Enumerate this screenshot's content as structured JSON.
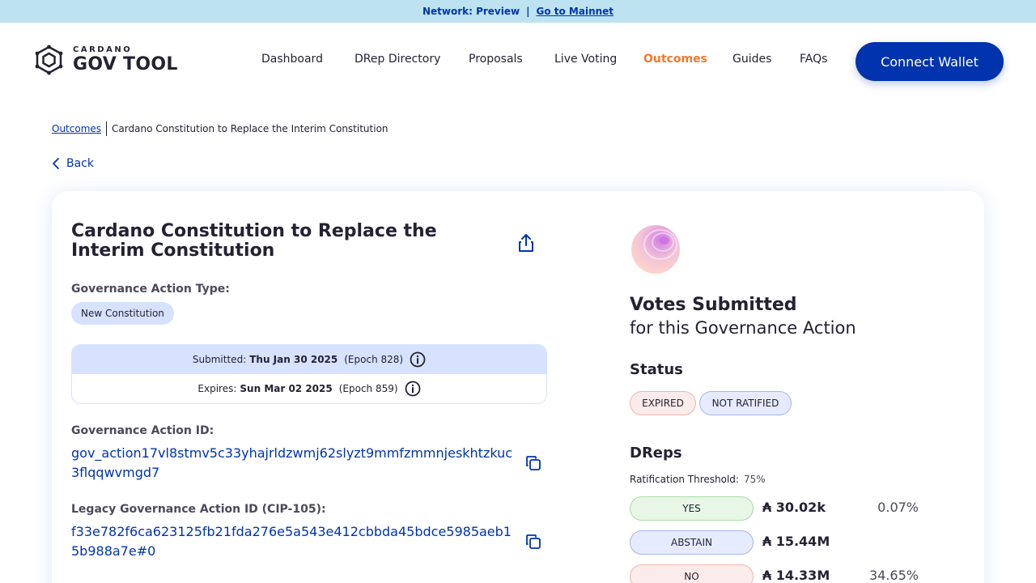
{
  "banner": {
    "network_text": "Network: Preview",
    "separator": "|",
    "mainnet_link": "Go to Mainnet"
  },
  "header": {
    "logo_small": "CARDANO",
    "logo_big": "GOV TOOL",
    "nav": [
      "Dashboard",
      "DRep Directory",
      "Proposals",
      "Live Voting",
      "Outcomes",
      "Guides",
      "FAQs"
    ],
    "active_nav": "Outcomes",
    "connect_label": "Connect Wallet"
  },
  "breadcrumb": {
    "link": "Outcomes",
    "current": "Cardano Constitution to Replace the Interim Constitution"
  },
  "back_label": "Back",
  "action": {
    "title": "Cardano Constitution to Replace the Interim Constitution",
    "type_label": "Governance Action Type:",
    "type_value": "New Constitution",
    "submitted_label": "Submitted:",
    "submitted_date": "Thu Jan 30 2025",
    "submitted_epoch": "(Epoch 828)",
    "expires_label": "Expires:",
    "expires_date": "Sun Mar 02 2025",
    "expires_epoch": "(Epoch 859)",
    "id_label": "Governance Action ID:",
    "id_value": "gov_action17vl8stmv5c33yhajrldzwmj62slyzt9mmfzmmnjeskhtzkuc3flqqwvmgd7",
    "legacy_label": "Legacy Governance Action ID (CIP-105):",
    "legacy_value": "f33e782f6ca623125fb21fda276e5a543e412cbbda45bdce5985aeb15b988a7e#0"
  },
  "votes": {
    "title": "Votes Submitted",
    "subtitle": "for this Governance Action",
    "status_heading": "Status",
    "status_chips": [
      "EXPIRED",
      "NOT RATIFIED"
    ],
    "dreps_heading": "DReps",
    "threshold_label": "Ratification Threshold:",
    "threshold_value": "75%",
    "rows": [
      {
        "label": "YES",
        "amount": "₳ 30.02k",
        "pct": "0.07%"
      },
      {
        "label": "ABSTAIN",
        "amount": "₳ 15.44M",
        "pct": ""
      },
      {
        "label": "NO",
        "amount": "₳ 14.33M",
        "pct": "34.65%"
      }
    ]
  },
  "colors": {
    "primary": "#0033ad",
    "active_nav": "#f5782a",
    "banner_bg": "#bde3f1"
  }
}
